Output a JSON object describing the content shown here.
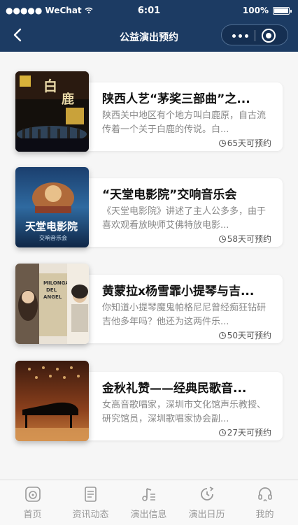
{
  "status_bar": {
    "carrier": "●●●●● WeChat",
    "time": "6:01",
    "battery": "100%"
  },
  "nav": {
    "title": "公益演出预约"
  },
  "cards": [
    {
      "title": "陕西人艺“茅奖三部曲”之...",
      "desc": "陕西关中地区有个地方叫白鹿原，自古流传着一个关于白鹿的传说。白...",
      "availability": "65天可预约"
    },
    {
      "title": "“天堂电影院”交响音乐会",
      "desc": "《天堂电影院》讲述了主人公多多，由于喜欢观看放映师艾佛特放电影...",
      "availability": "58天可预约"
    },
    {
      "title": "黄蒙拉x杨雪霏小提琴与吉...",
      "desc": "你知道小提琴魔鬼帕格尼尼曾经痴狂钻研吉他多年吗？他还为这两件乐...",
      "availability": "50天可预约"
    },
    {
      "title": "金秋礼赞——经典民歌音...",
      "desc": "女高音歌唱家，深圳市文化馆声乐教授、研究馆员，深圳歌唱家协会副...",
      "availability": "27天可预约"
    }
  ],
  "tabbar": [
    {
      "label": "首页",
      "icon": "music-disc-icon"
    },
    {
      "label": "资讯动态",
      "icon": "news-icon"
    },
    {
      "label": "演出信息",
      "icon": "music-note-icon"
    },
    {
      "label": "演出日历",
      "icon": "calendar-clock-icon"
    },
    {
      "label": "我的",
      "icon": "headphones-user-icon"
    }
  ]
}
